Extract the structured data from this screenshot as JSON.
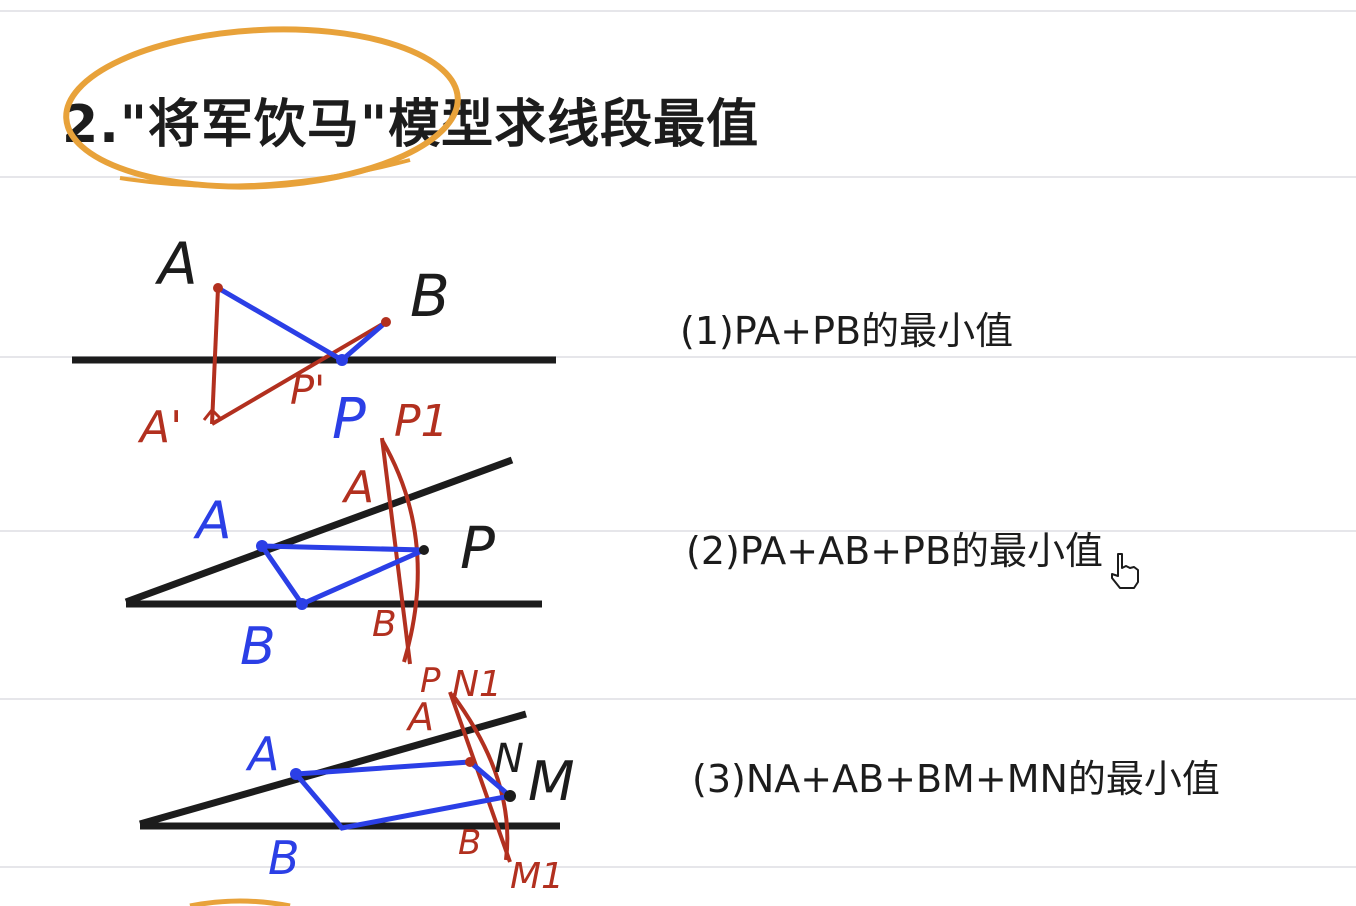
{
  "colors": {
    "ink": "#1c1c1c",
    "blue": "#2b3fe6",
    "red": "#b2301f",
    "highlight": "#e8a23a"
  },
  "title": "2.\"将军饮马\"模型求线段最值",
  "problems": [
    {
      "label": "(1)PA+PB的最小值"
    },
    {
      "label": "(2)PA+AB+PB的最小值"
    },
    {
      "label": "(3)NA+AB+BM+MN的最小值"
    }
  ],
  "fig1": {
    "A": "A",
    "B": "B",
    "P": "P",
    "A_prime": "A'",
    "P_prime": "P'"
  },
  "fig2": {
    "A": "A",
    "B": "B",
    "P": "P",
    "A_red": "A",
    "B_red": "B",
    "P1": "P1"
  },
  "fig3": {
    "A": "A",
    "B": "B",
    "N": "N",
    "M": "M",
    "N1": "N1",
    "M1": "M1",
    "A_red": "A",
    "B_red": "B",
    "P_red": "P"
  },
  "cursor_icon": "hand-pointer-icon"
}
